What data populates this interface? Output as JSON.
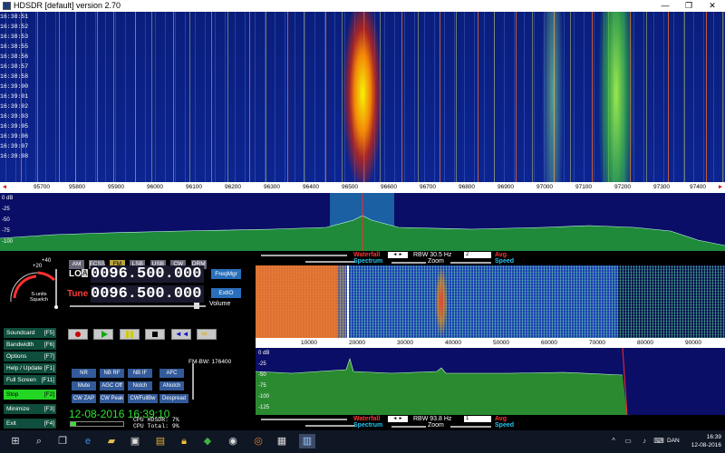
{
  "window": {
    "title": "HDSDR [default]  version 2.70"
  },
  "waterfall": {
    "timestamps": [
      "16:38:51",
      "16:38:52",
      "16:38:53",
      "16:38:55",
      "16:38:56",
      "16:38:57",
      "16:38:58",
      "16:39:00",
      "16:39:01",
      "16:39:02",
      "16:39:03",
      "16:39:05",
      "16:39:06",
      "16:39:07",
      "16:39:08"
    ]
  },
  "freq_axis": {
    "labels": [
      "95700",
      "95800",
      "95900",
      "96000",
      "96100",
      "96200",
      "96300",
      "96400",
      "96500",
      "96600",
      "96700",
      "96800",
      "96900",
      "97000",
      "97100",
      "97200",
      "97300",
      "97400"
    ]
  },
  "spectrum": {
    "y_labels": [
      "0 dB",
      "-25",
      "-50",
      "-75",
      "-100",
      "-125"
    ]
  },
  "modes": [
    "AM",
    "ECSS",
    "FM",
    "LSB",
    "USB",
    "CW",
    "DRM"
  ],
  "frequencies": {
    "lo_label": "LO",
    "lo_suffix": "A",
    "lo_value": "0096.500.000",
    "tune_label": "Tune",
    "tune_value": "0096.500.000"
  },
  "buttons": {
    "freq_mgr": "FreqMgr",
    "ext_io": "ExtIO",
    "volume": "Volume",
    "fm_bw": "FM-BW: 176400",
    "s_units": "S-units",
    "squelch": "Squelch"
  },
  "side_buttons": [
    {
      "label": "Soundcard",
      "key": "[F5]"
    },
    {
      "label": "Bandwidth",
      "key": "[F6]"
    },
    {
      "label": "Options",
      "key": "[F7]"
    },
    {
      "label": "Help / Update",
      "key": "[F1]"
    },
    {
      "label": "Full Screen",
      "key": "[F11]"
    },
    {
      "label": "Stop",
      "key": "[F2]"
    },
    {
      "label": "Minimize",
      "key": "[F3]"
    },
    {
      "label": "Exit",
      "key": "[F4]"
    }
  ],
  "feature_buttons": [
    "NR",
    "NB RF",
    "NB IF",
    "AFC",
    "Mute",
    "AGC Off",
    "Notch",
    "ANotch",
    "CW ZAP",
    "CW Peak",
    "CWFullBw",
    "Despread"
  ],
  "status": {
    "datetime": "12-08-2016 16:39:10",
    "cpu_hdsdr": "CPU HDSDR:  7%",
    "cpu_total": "CPU Total:  9%"
  },
  "top_ctrl": {
    "waterfall": "Waterfall",
    "rbw": "RBW 30.5 Hz",
    "dropdown": "2",
    "avg": "Avg",
    "spectrum": "Spectrum",
    "zoom": "Zoom",
    "speed": "Speed"
  },
  "bottom_ctrl": {
    "waterfall": "Waterfall",
    "rbw": "RBW 93.8 Hz",
    "dropdown": "1",
    "avg": "Avg",
    "spectrum": "Spectrum",
    "zoom": "Zoom",
    "speed": "Speed"
  },
  "sub_axis": {
    "labels": [
      "10000",
      "20000",
      "30000",
      "40000",
      "50000",
      "60000",
      "70000",
      "80000",
      "90000"
    ]
  },
  "sub_spectrum": {
    "y_labels": [
      "0 dB",
      "-25",
      "-50",
      "-75",
      "-100",
      "-125"
    ]
  },
  "tray": {
    "lang": "DAN",
    "time": "16:39",
    "date": "12-08-2016"
  }
}
